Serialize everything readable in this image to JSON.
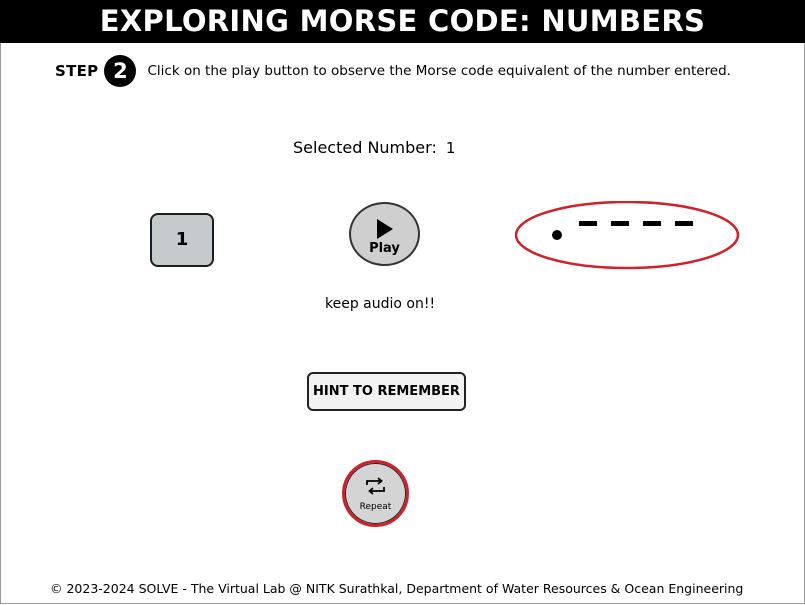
{
  "header": {
    "title": "EXPLORING MORSE CODE: NUMBERS"
  },
  "step": {
    "label": "STEP",
    "number": "2",
    "instruction": "Click on the play button to observe the Morse code equivalent of the number entered."
  },
  "selection": {
    "label": "Selected Number:",
    "value": "1"
  },
  "number_tile": {
    "label": "1"
  },
  "play_button": {
    "label": "Play",
    "icon": "play-icon"
  },
  "morse_output": {
    "symbols": [
      "dot",
      "dash",
      "dash",
      "dash",
      "dash"
    ],
    "highlight_color": "#d0202a"
  },
  "audio_note": "keep audio on!!",
  "hint_button": {
    "label": "HINT TO REMEMBER"
  },
  "repeat_button": {
    "label": "Repeat",
    "icon": "repeat-icon",
    "ring_color": "#d0202a"
  },
  "footer": {
    "text": "© 2023-2024 SOLVE - The Virtual Lab @ NITK Surathkal, Department of Water Resources & Ocean Engineering"
  }
}
